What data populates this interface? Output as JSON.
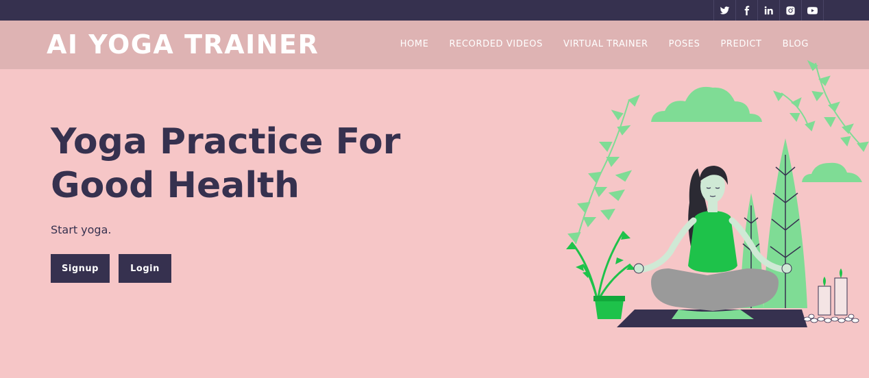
{
  "social": {
    "icons": [
      "twitter-icon",
      "facebook-icon",
      "linkedin-icon",
      "instagram-icon",
      "youtube-icon"
    ]
  },
  "brand": {
    "title": "AI YOGA TRAINER"
  },
  "nav": {
    "items": [
      "HOME",
      "RECORDED VIDEOS",
      "VIRTUAL TRAINER",
      "POSES",
      "PREDICT",
      "BLOG"
    ]
  },
  "hero": {
    "title_line1": "Yoga Practice For",
    "title_line2": "Good Health",
    "subtitle": "Start yoga.",
    "signup_label": "Signup",
    "login_label": "Login"
  },
  "colors": {
    "background": "#f6c6c7",
    "topbar": "#36314f",
    "navbar": "#deb3b3",
    "accent_dark": "#36314f",
    "plant_green": "#7fdc95",
    "shirt_green": "#1ec24a"
  }
}
